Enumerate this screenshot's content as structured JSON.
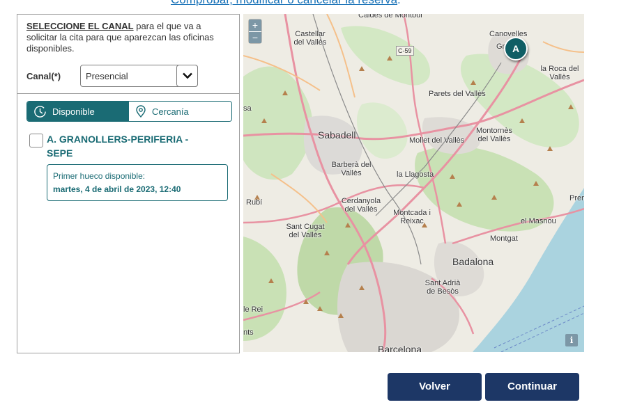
{
  "header": {
    "manage_link": "Comprobar, modificar o cancelar la reserva",
    "manage_link_suffix": "."
  },
  "panel": {
    "instruction_strong": "SELECCIONE EL CANAL",
    "instruction_rest": " para el que va a solicitar la cita para que aparezcan las oficinas disponibles.",
    "canal_label": "Canal(*)",
    "canal_value": "Presencial",
    "tabs": [
      {
        "label": "Disponible",
        "icon": "clock-icon"
      },
      {
        "label": "Cercanía",
        "icon": "location-pin-icon"
      }
    ],
    "office": {
      "name": "A. GRANOLLERS-PERIFERIA - SEPE",
      "slot_label": "Primer hueco disponible:",
      "slot_value": "martes, 4 de abril de 2023, 12:40"
    }
  },
  "map": {
    "zoom_in": "+",
    "zoom_out": "−",
    "info": "i",
    "marker": "A",
    "labels": {
      "caldes": "Caldes de Montbui",
      "castellar": "Castellar del Vallès",
      "canovelles": "Canovelles",
      "granollers": "Gr",
      "c59": "C-59",
      "roca": "la Roca del Vallès",
      "parets": "Parets del Vallès",
      "sabadell": "Sabadell",
      "mollet": "Mollet del Vallès",
      "montornes": "Montornès del Vallès",
      "barbera": "Barberà del Vallès",
      "llagosta": "la Llagosta",
      "rubi": "Rubí",
      "cerdanyola": "Cerdanyola del Vallès",
      "montcada": "Montcada i Reixac",
      "santcugat": "Sant Cugat del Vallès",
      "masnou": "el Masnou",
      "montgat": "Montgat",
      "badalona": "Badalona",
      "santadria": "Sant Adrià de Besòs",
      "barcelona": "Barcelona",
      "premia": "Prem",
      "sa": "sa",
      "lerei": "le Rei",
      "nts": "nts"
    }
  },
  "actions": {
    "back": "Volver",
    "next": "Continuar"
  },
  "colors": {
    "accent": "#1a6b74",
    "button": "#1d3766",
    "link": "#1a73b8"
  }
}
